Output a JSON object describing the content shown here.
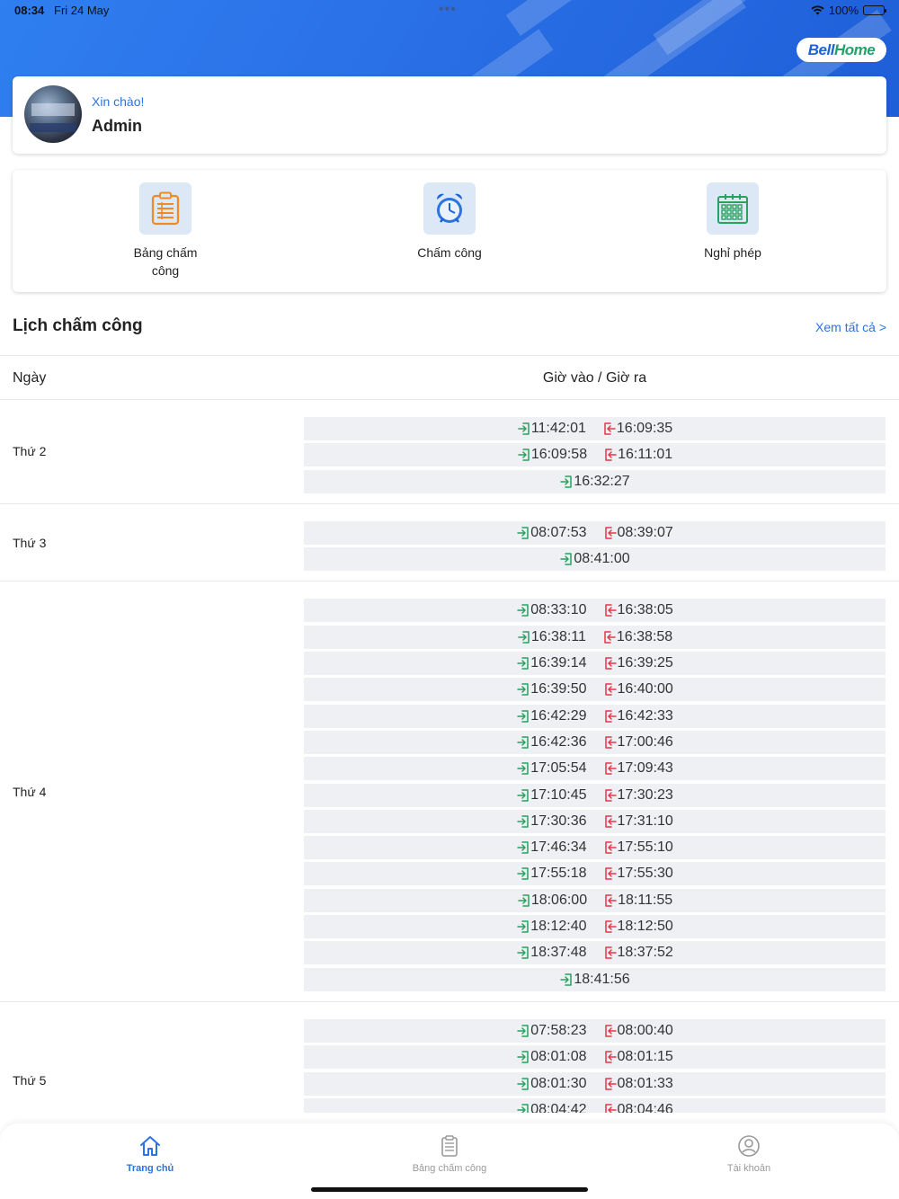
{
  "status_bar": {
    "time": "08:34",
    "date": "Fri 24 May",
    "battery": "100%"
  },
  "brand": {
    "logo_part1": "Bell",
    "logo_part2": "Home"
  },
  "greeting": {
    "hello": "Xin chào!",
    "name": "Admin"
  },
  "menu": [
    {
      "label": "Bảng chấm công",
      "icon": "clipboard-icon"
    },
    {
      "label": "Chấm công",
      "icon": "alarm-clock-icon"
    },
    {
      "label": "Nghỉ phép",
      "icon": "calendar-icon"
    }
  ],
  "schedule": {
    "title": "Lịch chấm công",
    "view_all": "Xem tất cả >",
    "col_day": "Ngày",
    "col_times": "Giờ vào / Giờ ra",
    "days": [
      {
        "day": "Thứ 2",
        "rows": [
          {
            "in": "11:42:01",
            "out": "16:09:35"
          },
          {
            "in": "16:09:58",
            "out": "16:11:01"
          },
          {
            "in": "16:32:27",
            "out": ""
          }
        ]
      },
      {
        "day": "Thứ 3",
        "rows": [
          {
            "in": "08:07:53",
            "out": "08:39:07"
          },
          {
            "in": "08:41:00",
            "out": ""
          }
        ]
      },
      {
        "day": "Thứ 4",
        "rows": [
          {
            "in": "08:33:10",
            "out": "16:38:05"
          },
          {
            "in": "16:38:11",
            "out": "16:38:58"
          },
          {
            "in": "16:39:14",
            "out": "16:39:25"
          },
          {
            "in": "16:39:50",
            "out": "16:40:00"
          },
          {
            "in": "16:42:29",
            "out": "16:42:33"
          },
          {
            "in": "16:42:36",
            "out": "17:00:46"
          },
          {
            "in": "17:05:54",
            "out": "17:09:43"
          },
          {
            "in": "17:10:45",
            "out": "17:30:23"
          },
          {
            "in": "17:30:36",
            "out": "17:31:10"
          },
          {
            "in": "17:46:34",
            "out": "17:55:10"
          },
          {
            "in": "17:55:18",
            "out": "17:55:30"
          },
          {
            "in": "18:06:00",
            "out": "18:11:55"
          },
          {
            "in": "18:12:40",
            "out": "18:12:50"
          },
          {
            "in": "18:37:48",
            "out": "18:37:52"
          },
          {
            "in": "18:41:56",
            "out": ""
          }
        ]
      },
      {
        "day": "Thứ 5",
        "rows": [
          {
            "in": "07:58:23",
            "out": "08:00:40"
          },
          {
            "in": "08:01:08",
            "out": "08:01:15"
          },
          {
            "in": "08:01:30",
            "out": "08:01:33"
          },
          {
            "in": "08:04:42",
            "out": "08:04:46"
          },
          {
            "in": "",
            "out": ""
          }
        ]
      }
    ]
  },
  "tabbar": [
    {
      "label": "Trang chủ",
      "icon": "home-icon",
      "active": true
    },
    {
      "label": "Bảng chấm công",
      "icon": "clipboard-icon",
      "active": false
    },
    {
      "label": "Tài khoản",
      "icon": "user-icon",
      "active": false
    }
  ],
  "colors": {
    "accent": "#2b73e0",
    "check_in": "#27a35e",
    "check_out": "#e0394a",
    "row_bg": "#eef0f3"
  }
}
